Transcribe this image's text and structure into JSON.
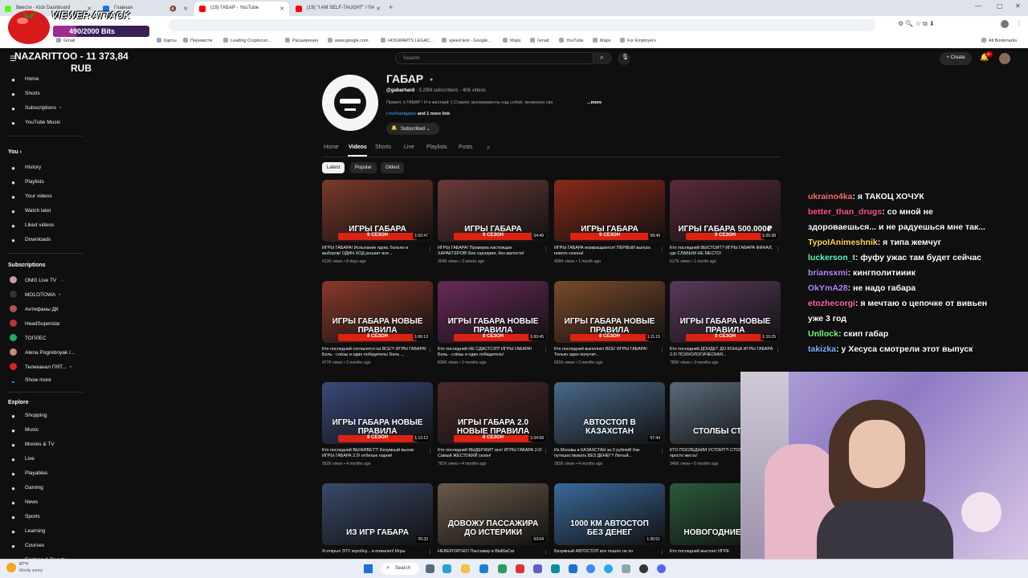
{
  "browser": {
    "tabs": [
      {
        "label": "Ввести - Kick Dashboard"
      },
      {
        "label": "Главная"
      },
      {
        "label": "(19) ГАБАР - YouTube"
      },
      {
        "label": "(19) \"I AM SELF-TAUGHT\" / ©#"
      }
    ],
    "bookmarks": [
      "Gmail",
      "Карты",
      "Перевести",
      "Leading Cryptocurr...",
      "Расширения",
      "www.google.com",
      "HOGWARTS LEGAC...",
      "speed test - Google...",
      "Maps",
      "Gmail",
      "YouTube",
      "Maps",
      "For Employers"
    ],
    "all_bookmarks": "All Bookmarks"
  },
  "overlay": {
    "alert_title": "VIEWER ATTACK",
    "alert_progress": "490/2000 Bits",
    "alert_progress_value": 0.245,
    "donation": "NAZARITTOO - 11 373,84",
    "donation_currency": "RUB"
  },
  "sidebar": {
    "main": [
      {
        "label": "Home",
        "icon": "home-icon"
      },
      {
        "label": "Shorts",
        "icon": "shorts-icon"
      },
      {
        "label": "Subscriptions",
        "icon": "subscriptions-icon"
      },
      {
        "label": "YouTube Music",
        "icon": "music-icon"
      }
    ],
    "you_label": "You",
    "you": [
      {
        "label": "History",
        "icon": "history-icon"
      },
      {
        "label": "Playlists",
        "icon": "playlists-icon"
      },
      {
        "label": "Your videos",
        "icon": "your-videos-icon"
      },
      {
        "label": "Watch later",
        "icon": "watch-later-icon"
      },
      {
        "label": "Liked videos",
        "icon": "like-icon"
      },
      {
        "label": "Downloads",
        "icon": "download-icon"
      }
    ],
    "subscriptions_label": "Subscriptions",
    "subscriptions": [
      {
        "label": "OMG Live TV",
        "color": "#c9a"
      },
      {
        "label": "MOLOTOWA",
        "color": "#333"
      },
      {
        "label": "Антифаны ДК",
        "color": "#a55"
      },
      {
        "label": "HeadSuperstar",
        "color": "#b33"
      },
      {
        "label": "ТОПЛЕС",
        "color": "#2a6"
      },
      {
        "label": "Alena Pogrebnyak /...",
        "color": "#c87"
      },
      {
        "label": "Телеканал ПЯТ...",
        "color": "#d22"
      }
    ],
    "show_more": "Show more",
    "explore_label": "Explore",
    "explore": [
      {
        "label": "Shopping",
        "icon": "shopping-icon"
      },
      {
        "label": "Music",
        "icon": "music-note-icon"
      },
      {
        "label": "Movies & TV",
        "icon": "movies-icon"
      },
      {
        "label": "Live",
        "icon": "live-icon"
      },
      {
        "label": "Playables",
        "icon": "playables-icon"
      },
      {
        "label": "Gaming",
        "icon": "gaming-icon"
      },
      {
        "label": "News",
        "icon": "news-icon"
      },
      {
        "label": "Sports",
        "icon": "sports-icon"
      },
      {
        "label": "Learning",
        "icon": "learning-icon"
      },
      {
        "label": "Courses",
        "icon": "courses-icon"
      },
      {
        "label": "Fashion & Beauty",
        "icon": "fashion-icon"
      }
    ]
  },
  "header": {
    "search_placeholder": "Search",
    "create_label": "+ Create",
    "notif_count": "9+"
  },
  "channel": {
    "name": "ГАБАР",
    "handle": "@gabarhard",
    "stats": "3.29M subscribers · 406 videos",
    "description": "Привет, я ГАБАР ! И я жесткий :) Ставлю эксперименты над собой, проверяю сво",
    "more": "...more",
    "link": "t.me/hardgabar",
    "more_links": "and 1 more link",
    "subscribed": "Subscribed",
    "tabs": [
      "Home",
      "Videos",
      "Shorts",
      "Live",
      "Playlists",
      "Posts"
    ],
    "chips": [
      "Latest",
      "Popular",
      "Oldest"
    ]
  },
  "videos": [
    {
      "banner": "ИГРЫ ГАБАРА",
      "sub": "9 СЕЗОН",
      "dur": "1:02:47",
      "title": "ИГРЫ ГАБАРА! Испытание ядом, больно и выборов! ОДИН ХОД решает все...",
      "meta": "413K views • 8 days ago",
      "bg": "#7a3a2a"
    },
    {
      "banner": "ИГРЫ ГАБАРА",
      "sub": "9 СЕЗОН",
      "dur": "54:49",
      "title": "ИГРЫ ГАБАРА! Проверка настоящих ХАРАКТЕРОВ! Без сценария, без жалости!",
      "meta": "304K views • 3 weeks ago",
      "bg": "#6a3a3a"
    },
    {
      "banner": "ИГРЫ ГАБАРА",
      "sub": "9 СЕЗОН",
      "dur": "58:49",
      "title": "ИГРЫ ГАБАРА возвращаются! ПЕРВЫЙ выпуск нового сезона!",
      "meta": "409K views • 1 month ago",
      "bg": "#8a2a1a"
    },
    {
      "banner": "ИГРЫ ГАБАРА 500.000₽",
      "sub": "9 СЕЗОН",
      "dur": "1:05:38",
      "title": "Кто последний ВЫСТОИТ? ИГРЫ ГАБАРА ФИНАЛ, где СЛАБЫМ НЕ МЕСТО!",
      "meta": "617K views • 1 month ago",
      "bg": "#5a2a3a"
    },
    {
      "banner": "ИГРЫ ГАБАРА НОВЫЕ ПРАВИЛА",
      "sub": "8 СЕЗОН",
      "dur": "1:06:13",
      "title": "Кто последний согласится на ВСЕ?! ИГРЫ ГАБАРА! Боль - слёзы и один победитель! Боль ...",
      "meta": "477K views • 2 months ago",
      "bg": "#8a3a2a"
    },
    {
      "banner": "ИГРЫ ГАБАРА НОВЫЕ ПРАВИЛА",
      "sub": "8 СЕЗОН",
      "dur": "1:00:45",
      "title": "Кто последний НЕ СДАСТСЯ?! ИГРЫ ГАБАРА! Боль - слёзы и один победитель!",
      "meta": "839K views • 2 months ago",
      "bg": "#6a2a5a"
    },
    {
      "banner": "ИГРЫ ГАБАРА НОВЫЕ ПРАВИЛА",
      "sub": "8 СЕЗОН",
      "dur": "1:11:15",
      "title": "Кто последний выполнит ВСЕ! ИГРЫ ГАБАРА! Только один получит...",
      "meta": "691K views • 3 months ago",
      "bg": "#7a4a2a"
    },
    {
      "banner": "ИГРЫ ГАБАРА НОВЫЕ ПРАВИЛА",
      "sub": "8 СЕЗОН",
      "dur": "1:10:25",
      "title": "Кто последний ДОЙДЕТ ДО КОНЦА ИГРЫ ГАБАРА 2.0! ПСИХОЛОГИЧЕСКАЯ...",
      "meta": "789K views • 3 months ago",
      "bg": "#5a3a5a"
    },
    {
      "banner": "ИГРЫ ГАБАРА НОВЫЕ ПРАВИЛА",
      "sub": "8 СЕЗОН",
      "dur": "1:12:12",
      "title": "Кто последний ВЫЖИВЕТ?! Безумный вызов: ИГРЫ ГАБАРА 2.0! отбитые парни!",
      "meta": "562K views • 4 months ago",
      "bg": "#3a4a7a"
    },
    {
      "banner": "ИГРЫ ГАБАРА 2.0 НОВЫЕ ПРАВИЛА",
      "sub": "8 СЕЗОН",
      "dur": "1:04:58",
      "title": "Кто последний ВЫДЕРЖИТ все! ИГРЫ ГАБАРА 2.0! Самый ЖЕСТОКИЙ сезон!",
      "meta": "781K views • 4 months ago",
      "bg": "#4a2a2a"
    },
    {
      "banner": "АВТОСТОП В КАЗАХСТАН",
      "sub": "",
      "dur": "57:44",
      "title": "Из Москвы в КАЗАХСТАН за 0 рублей! Как путешествовать БЕЗ ДЕНЕГ? Лютый...",
      "meta": "282K views • 4 months ago",
      "bg": "#4a6a8a"
    },
    {
      "banner": "СТОЛБЫ СТРАХ",
      "sub": "",
      "dur": "",
      "title": "КТО ПОСЛЕДНИЙ УСТОИТ?! СТОЛБЫ СТРАХА - просто жесть!",
      "meta": "346K views • 5 months ago",
      "bg": "#5a6a7a"
    },
    {
      "banner": "ИЗ ИГР ГАБАРА",
      "sub": "",
      "dur": "25:33",
      "title": "Я открыл ЭТУ коробку... и пожалел! Игры",
      "meta": "",
      "bg": "#3a4a6a"
    },
    {
      "banner": "ДОВОЖУ ПАССАЖИРА ДО ИСТЕРИКИ",
      "sub": "",
      "dur": "53:04",
      "title": "НЕВЕРОЯТНО! Пассажир в BlaBlaCar",
      "meta": "",
      "bg": "#6a5a4a"
    },
    {
      "banner": "1000 КМ АВТОСТОП БЕЗ ДЕНЕГ",
      "sub": "",
      "dur": "1:30:51",
      "title": "Безумный АВТОСТОП все пошло не по",
      "meta": "",
      "bg": "#3a6a9a"
    },
    {
      "banner": "НОВОГОДНИЕ ИГРЫ",
      "sub": "",
      "dur": "",
      "title": "Кто последний выстоит ИГРЕ",
      "meta": "",
      "bg": "#2a5a3a"
    }
  ],
  "chat": [
    {
      "user": "ukraino4ka",
      "color": "#ff7070",
      "text": "я ТАКОЦ ХОЧУК"
    },
    {
      "user": "better_than_drugs",
      "color": "#ff4f8b",
      "text": "со мной не"
    },
    {
      "user": "",
      "color": "#fff",
      "text": "здороваешься... и не радуешься мне так..."
    },
    {
      "user": "TypoIAnimeshnik",
      "color": "#ffd35c",
      "text": "я типа жемчуг"
    },
    {
      "user": "luckerson_t",
      "color": "#5cffc0",
      "text": "фуфу ужас там будет сейчас"
    },
    {
      "user": "briansxmi",
      "color": "#b38bff",
      "text": "кингполитииик"
    },
    {
      "user": "OkYmA28",
      "color": "#b38bff",
      "text": "не надо габара"
    },
    {
      "user": "etozhecorgi",
      "color": "#ff6ab0",
      "text": "я мечтаю о цепочке от вивьен"
    },
    {
      "user": "",
      "color": "#fff",
      "text": "уже 3 год"
    },
    {
      "user": "Unllock",
      "color": "#7dff7d",
      "text": "скип габар"
    },
    {
      "user": "takizka",
      "color": "#7db3ff",
      "text": "у Хесуса смотрели этот выпуск"
    }
  ],
  "taskbar": {
    "weather_temp": "87°F",
    "weather_text": "Mostly sunny",
    "search_label": "Search"
  }
}
